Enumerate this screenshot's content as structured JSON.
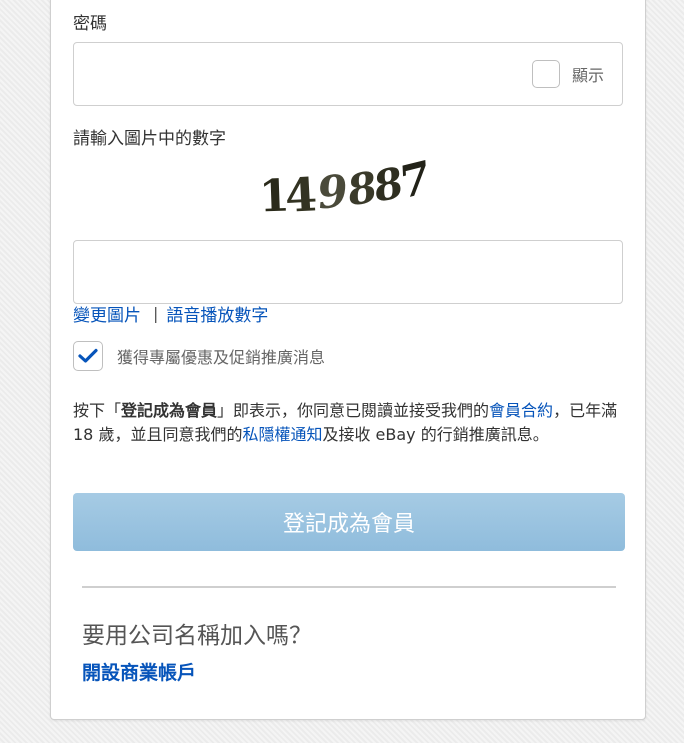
{
  "password": {
    "label": "密碼",
    "value": "",
    "show_label": "顯示"
  },
  "captcha": {
    "label": "請輸入圖片中的數字",
    "image_text": "149887",
    "input_value": "",
    "change_image_link": "變更圖片",
    "separator": "|",
    "audio_link": "語音播放數字"
  },
  "promo": {
    "checked": true,
    "label": "獲得專屬優惠及促銷推廣消息"
  },
  "terms": {
    "part1": "按下「",
    "bold": "登記成為會員",
    "part2": "」即表示，你同意已閱讀並接受我們的",
    "user_agreement_link": "會員合約",
    "part3": "，已年滿 18 歲，並且同意我們的",
    "privacy_link": "私隱權通知",
    "part4": "及接收 eBay 的行銷推廣訊息。"
  },
  "register_button": "登記成為會員",
  "business": {
    "question": "要用公司名稱加入嗎？",
    "link": "開設商業帳戶"
  },
  "colors": {
    "link": "#0654ba",
    "button_bg": "#9cc5e1",
    "checkmark": "#0654ba"
  }
}
